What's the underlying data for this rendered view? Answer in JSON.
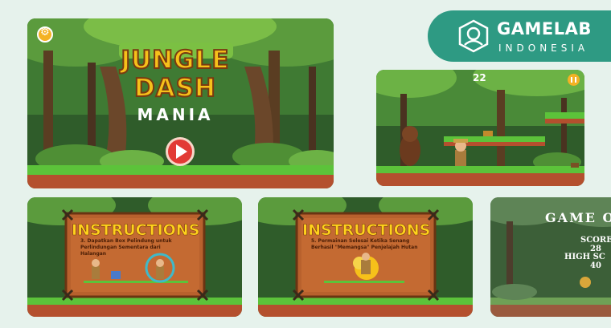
{
  "brand": {
    "name": "GAMELAB",
    "sub": "INDONESIA"
  },
  "title_screen": {
    "line1": "JUNGLE",
    "line2": "DASH",
    "line3": "MANIA"
  },
  "gameplay": {
    "score": "22"
  },
  "instructions_1": {
    "heading": "INSTRUCTIONS",
    "text": "3. Dapatkan Box Pelindung untuk Perlindungan Sementara dari Halangan"
  },
  "instructions_2": {
    "heading": "INSTRUCTIONS",
    "text": "5. Permainan Selesai Ketika Senang Berhasil \"Memangsa\" Penjelajah Hutan"
  },
  "game_over": {
    "title": "GAME O",
    "score_label": "SCORE",
    "score_value": "28",
    "high_label": "HIGH SC",
    "high_value": "40"
  },
  "colors": {
    "brand": "#2e9a83",
    "grass": "#5cc33a",
    "soil": "#b4502e",
    "board": "#b8612d"
  }
}
